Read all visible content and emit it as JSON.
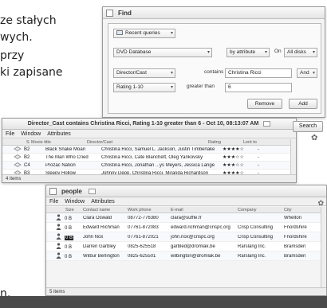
{
  "background_text": {
    "line1": "ze stałych",
    "line2": "wych.",
    "line3": "przy",
    "line4": "ki zapisane",
    "trailing": "n."
  },
  "find_window": {
    "title": "Find",
    "recent_label": "Recent queries",
    "database": "DVD Database",
    "by_attribute": "by attribute",
    "on_label": "On",
    "on_value": "All disks",
    "row1": {
      "field": "Director/Cast",
      "op": "contains",
      "value": "Christina Ricci",
      "conj": "And"
    },
    "row2": {
      "field": "Rating 1-10",
      "op": "greater than",
      "value": "6"
    },
    "remove_label": "Remove",
    "add_label": "Add",
    "search_label": "Search"
  },
  "director_window": {
    "title": "Director_Cast contains Christina Ricci, Rating 1-10 greater than 6 - Oct 10, 08:13:07 AM",
    "menu": [
      "File",
      "Window",
      "Attributes"
    ],
    "columns": [
      "Shelf",
      "Movie title",
      "Director/Cast",
      "Rating",
      "Lent to"
    ],
    "rows": [
      {
        "shelf": "B2",
        "title": "Black Snake Moan",
        "cast": "Christina Ricci, Samuel L. Jackson, Justin Timberlake",
        "rating": "★★★★☆",
        "lent": "-"
      },
      {
        "shelf": "B2",
        "title": "The Man Who Cried",
        "cast": "Christina Ricci, Cate Blanchett, Oleg Yankovsky",
        "rating": "★★★☆☆",
        "lent": "-"
      },
      {
        "shelf": "C4",
        "title": "Prozac Nation",
        "cast": "Christina Ricci, Jonathan ...ys Meyers, Jessica Lange",
        "rating": "★★★☆☆",
        "lent": "-"
      },
      {
        "shelf": "B3",
        "title": "Sleepy Hollow",
        "cast": "Johnny Depp, Christina Ricci, Miranda Richardson",
        "rating": "★★★★☆",
        "lent": "-"
      }
    ],
    "status": "4 items"
  },
  "people_window": {
    "title": "people",
    "menu": [
      "File",
      "Window",
      "Attributes"
    ],
    "columns": [
      "Size",
      "Contact name",
      "Work phone",
      "E-mail",
      "Company",
      "City"
    ],
    "rows": [
      {
        "size": "0 B",
        "name": "Clara Oswald",
        "phone": "08772-776380",
        "email": "clara@suffle.fr",
        "company": "",
        "city": "Whelton"
      },
      {
        "size": "0 B",
        "name": "Edward Richman",
        "phone": "07761-872083",
        "email": "edward.richman@crispc.org",
        "company": "Crisp Consulting",
        "city": "Fnordshire"
      },
      {
        "size": "0 B",
        "name": "John Nox",
        "phone": "07761-872021",
        "email": "john.nox@crispc.org",
        "company": "Crisp Consulting",
        "city": "Fnordshire"
      },
      {
        "size": "0 B",
        "name": "Darren Garbley",
        "phone": "0825-625518",
        "email": "garbled@dromlak.be",
        "company": "Rarslang Inc.",
        "city": "Bramsden"
      },
      {
        "size": "0 B",
        "name": "Wilbur Berlington",
        "phone": "0825-625501",
        "email": "wilbington@dromlak.be",
        "company": "Rarslang Inc.",
        "city": "Bramsden"
      }
    ],
    "status": "5 items"
  }
}
